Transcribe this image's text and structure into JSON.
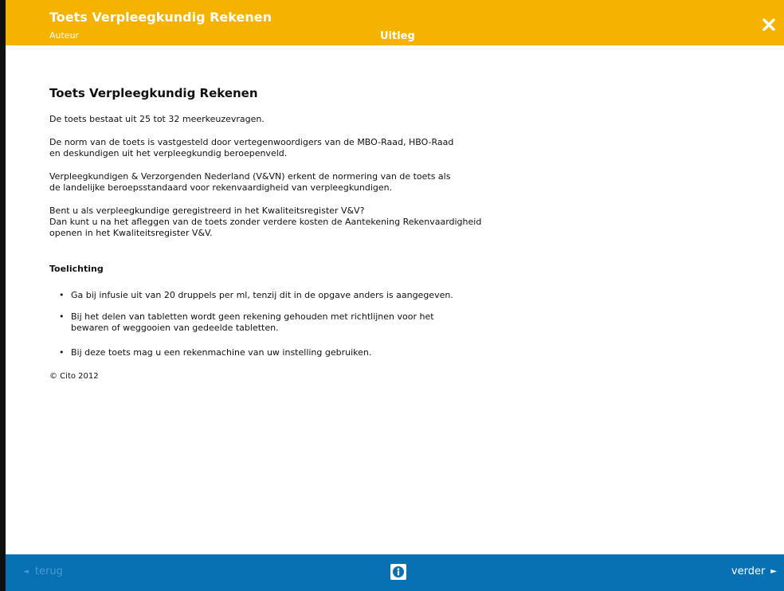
{
  "header": {
    "app_title": "Toets Verpleegkundig Rekenen",
    "author_label": "Auteur",
    "section_title": "Uitleg",
    "close_icon": "close-icon"
  },
  "main": {
    "title": "Toets Verpleegkundig Rekenen",
    "paragraphs": [
      "De toets bestaat uit 25 tot 32 meerkeuzevragen.",
      "De norm van de toets is vastgesteld door vertegenwoordigers van de MBO-Raad, HBO-Raad\nen deskundigen uit het verpleegkundig beroepenveld.",
      "Verpleegkundigen & Verzorgenden Nederland (V&VN) erkent de normering van de toets als\nde landelijke beroepsstandaard voor rekenvaardigheid van verpleegkundigen.",
      "Bent u als verpleegkundige geregistreerd in het Kwaliteitsregister V&V?\nDan kunt u na het afleggen van de toets zonder verdere kosten de Aantekening Rekenvaardigheid\nopenen in het Kwaliteitsregister V&V."
    ],
    "notes_heading": "Toelichting",
    "notes": [
      "Ga bij infusie uit van 20 druppels per ml, tenzij dit in de opgave anders is aangegeven.",
      "Bij het delen van tabletten wordt geen rekening gehouden met richtlijnen voor het\nbewaren of weggooien van gedeelde tabletten.",
      "Bij deze toets mag u een rekenmachine van uw instelling gebruiken."
    ],
    "bullet": "•",
    "copyright": "© Cito 2012"
  },
  "footer": {
    "back_label": "terug",
    "back_arrow": "◄",
    "next_label": "verder",
    "next_arrow": "►",
    "info_icon": "info-icon"
  },
  "colors": {
    "header_bg": "#f5b300",
    "footer_bg": "#0871b4",
    "disabled_text": "#4c98cf"
  }
}
